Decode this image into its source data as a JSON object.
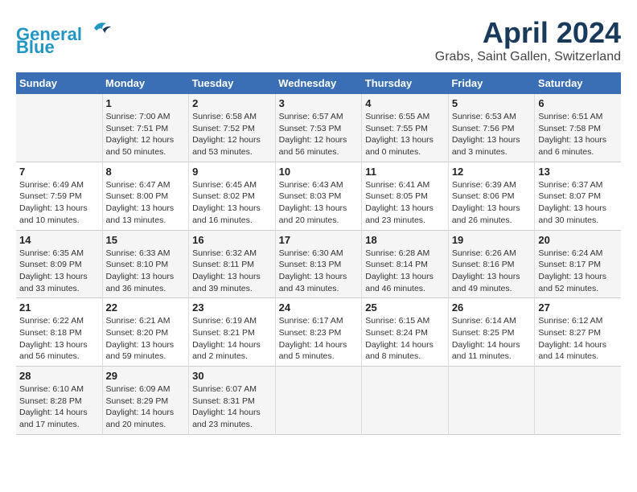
{
  "header": {
    "logo_line1": "General",
    "logo_line2": "Blue",
    "title": "April 2024",
    "subtitle": "Grabs, Saint Gallen, Switzerland"
  },
  "calendar": {
    "days_of_week": [
      "Sunday",
      "Monday",
      "Tuesday",
      "Wednesday",
      "Thursday",
      "Friday",
      "Saturday"
    ],
    "weeks": [
      [
        {
          "day": "",
          "info": ""
        },
        {
          "day": "1",
          "info": "Sunrise: 7:00 AM\nSunset: 7:51 PM\nDaylight: 12 hours\nand 50 minutes."
        },
        {
          "day": "2",
          "info": "Sunrise: 6:58 AM\nSunset: 7:52 PM\nDaylight: 12 hours\nand 53 minutes."
        },
        {
          "day": "3",
          "info": "Sunrise: 6:57 AM\nSunset: 7:53 PM\nDaylight: 12 hours\nand 56 minutes."
        },
        {
          "day": "4",
          "info": "Sunrise: 6:55 AM\nSunset: 7:55 PM\nDaylight: 13 hours\nand 0 minutes."
        },
        {
          "day": "5",
          "info": "Sunrise: 6:53 AM\nSunset: 7:56 PM\nDaylight: 13 hours\nand 3 minutes."
        },
        {
          "day": "6",
          "info": "Sunrise: 6:51 AM\nSunset: 7:58 PM\nDaylight: 13 hours\nand 6 minutes."
        }
      ],
      [
        {
          "day": "7",
          "info": "Sunrise: 6:49 AM\nSunset: 7:59 PM\nDaylight: 13 hours\nand 10 minutes."
        },
        {
          "day": "8",
          "info": "Sunrise: 6:47 AM\nSunset: 8:00 PM\nDaylight: 13 hours\nand 13 minutes."
        },
        {
          "day": "9",
          "info": "Sunrise: 6:45 AM\nSunset: 8:02 PM\nDaylight: 13 hours\nand 16 minutes."
        },
        {
          "day": "10",
          "info": "Sunrise: 6:43 AM\nSunset: 8:03 PM\nDaylight: 13 hours\nand 20 minutes."
        },
        {
          "day": "11",
          "info": "Sunrise: 6:41 AM\nSunset: 8:05 PM\nDaylight: 13 hours\nand 23 minutes."
        },
        {
          "day": "12",
          "info": "Sunrise: 6:39 AM\nSunset: 8:06 PM\nDaylight: 13 hours\nand 26 minutes."
        },
        {
          "day": "13",
          "info": "Sunrise: 6:37 AM\nSunset: 8:07 PM\nDaylight: 13 hours\nand 30 minutes."
        }
      ],
      [
        {
          "day": "14",
          "info": "Sunrise: 6:35 AM\nSunset: 8:09 PM\nDaylight: 13 hours\nand 33 minutes."
        },
        {
          "day": "15",
          "info": "Sunrise: 6:33 AM\nSunset: 8:10 PM\nDaylight: 13 hours\nand 36 minutes."
        },
        {
          "day": "16",
          "info": "Sunrise: 6:32 AM\nSunset: 8:11 PM\nDaylight: 13 hours\nand 39 minutes."
        },
        {
          "day": "17",
          "info": "Sunrise: 6:30 AM\nSunset: 8:13 PM\nDaylight: 13 hours\nand 43 minutes."
        },
        {
          "day": "18",
          "info": "Sunrise: 6:28 AM\nSunset: 8:14 PM\nDaylight: 13 hours\nand 46 minutes."
        },
        {
          "day": "19",
          "info": "Sunrise: 6:26 AM\nSunset: 8:16 PM\nDaylight: 13 hours\nand 49 minutes."
        },
        {
          "day": "20",
          "info": "Sunrise: 6:24 AM\nSunset: 8:17 PM\nDaylight: 13 hours\nand 52 minutes."
        }
      ],
      [
        {
          "day": "21",
          "info": "Sunrise: 6:22 AM\nSunset: 8:18 PM\nDaylight: 13 hours\nand 56 minutes."
        },
        {
          "day": "22",
          "info": "Sunrise: 6:21 AM\nSunset: 8:20 PM\nDaylight: 13 hours\nand 59 minutes."
        },
        {
          "day": "23",
          "info": "Sunrise: 6:19 AM\nSunset: 8:21 PM\nDaylight: 14 hours\nand 2 minutes."
        },
        {
          "day": "24",
          "info": "Sunrise: 6:17 AM\nSunset: 8:23 PM\nDaylight: 14 hours\nand 5 minutes."
        },
        {
          "day": "25",
          "info": "Sunrise: 6:15 AM\nSunset: 8:24 PM\nDaylight: 14 hours\nand 8 minutes."
        },
        {
          "day": "26",
          "info": "Sunrise: 6:14 AM\nSunset: 8:25 PM\nDaylight: 14 hours\nand 11 minutes."
        },
        {
          "day": "27",
          "info": "Sunrise: 6:12 AM\nSunset: 8:27 PM\nDaylight: 14 hours\nand 14 minutes."
        }
      ],
      [
        {
          "day": "28",
          "info": "Sunrise: 6:10 AM\nSunset: 8:28 PM\nDaylight: 14 hours\nand 17 minutes."
        },
        {
          "day": "29",
          "info": "Sunrise: 6:09 AM\nSunset: 8:29 PM\nDaylight: 14 hours\nand 20 minutes."
        },
        {
          "day": "30",
          "info": "Sunrise: 6:07 AM\nSunset: 8:31 PM\nDaylight: 14 hours\nand 23 minutes."
        },
        {
          "day": "",
          "info": ""
        },
        {
          "day": "",
          "info": ""
        },
        {
          "day": "",
          "info": ""
        },
        {
          "day": "",
          "info": ""
        }
      ]
    ]
  }
}
